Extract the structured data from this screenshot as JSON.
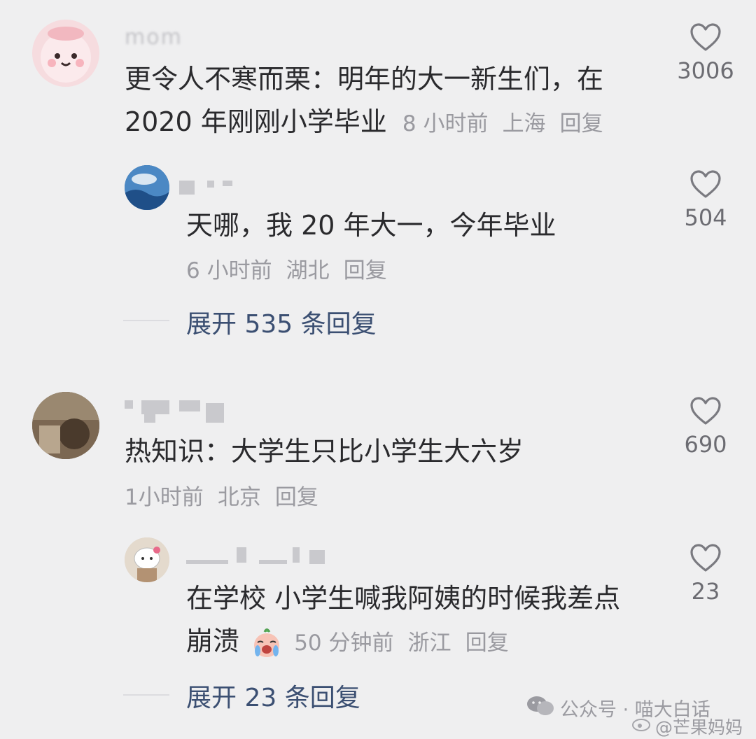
{
  "comments": [
    {
      "username": "mom",
      "text_line1": "更令人不寒而栗：明年的大一新生们，在",
      "text_line2": "2020 年刚刚小学毕业",
      "time": "8 小时前",
      "location": "上海",
      "reply_label": "回复",
      "likes": "3006",
      "reply": {
        "text": "天哪，我 20 年大一，今年毕业",
        "time": "6 小时前",
        "location": "湖北",
        "reply_label": "回复",
        "likes": "504"
      },
      "expand_label": "展开 535 条回复"
    },
    {
      "text": "热知识：大学生只比小学生大六岁",
      "time": "1小时前",
      "location": "北京",
      "reply_label": "回复",
      "likes": "690",
      "reply": {
        "text_line1": "在学校 小学生喊我阿姨的时候我差点",
        "text_line2": "崩溃",
        "time": "50 分钟前",
        "location": "浙江",
        "reply_label": "回复",
        "likes": "23"
      },
      "expand_label": "展开 23 条回复"
    }
  ],
  "watermark": {
    "text1": "公众号 · 喵大白话",
    "text2": "@芒果妈妈"
  },
  "colors": {
    "background": "#efeff0",
    "text": "#2a2a2d",
    "meta": "#9a9aa0",
    "expand": "#3b4f72"
  },
  "icons": [
    "heart-icon",
    "wechat-icon",
    "weibo-icon",
    "crying-emoji-icon"
  ]
}
